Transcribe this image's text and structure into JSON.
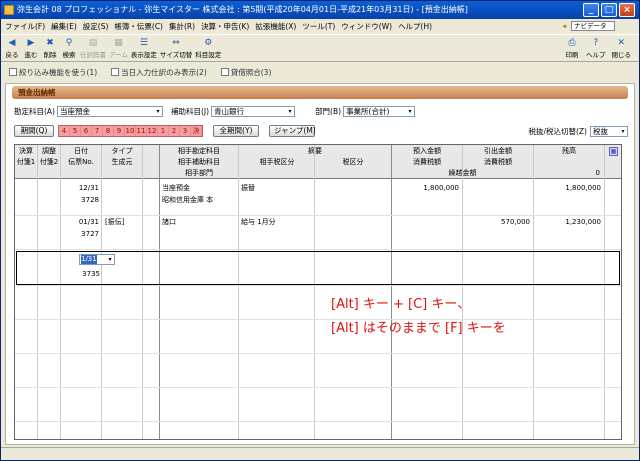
{
  "window": {
    "title": "弥生会計 08 プロフェッショナル - 弥生マイスター 株式会社 : 第5期(平成20年04月01日-平成21年03月31日) - [預金出納帳]"
  },
  "menu": {
    "items": [
      "ファイル(F)",
      "編集(E)",
      "設定(S)",
      "帳簿・伝票(C)",
      "集計(R)",
      "決算・申告(K)",
      "拡張機能(X)",
      "ツール(T)",
      "ウィンドウ(W)",
      "ヘルプ(H)"
    ],
    "navi_label": "ナビデータ"
  },
  "toolbar": {
    "items": [
      {
        "label": "戻る",
        "icon": "back-arrow-icon",
        "enabled": true
      },
      {
        "label": "進む",
        "icon": "forward-arrow-icon",
        "enabled": true
      },
      {
        "label": "削除",
        "icon": "delete-icon",
        "enabled": true
      },
      {
        "label": "検索",
        "icon": "search-icon",
        "enabled": true
      },
      {
        "label": "仕訳辞書",
        "icon": "dictionary-icon",
        "enabled": false
      },
      {
        "label": "アーム",
        "icon": "arm-icon",
        "enabled": false
      },
      {
        "label": "表示設定",
        "icon": "display-settings-icon",
        "enabled": true
      },
      {
        "label": "サイズ切替",
        "icon": "resize-icon",
        "enabled": true
      },
      {
        "label": "科目設定",
        "icon": "account-settings-icon",
        "enabled": true
      }
    ],
    "right": [
      {
        "label": "印刷",
        "icon": "print-icon"
      },
      {
        "label": "ヘルプ",
        "icon": "help-icon"
      },
      {
        "label": "閉じる",
        "icon": "close-icon"
      }
    ]
  },
  "options": {
    "items": [
      "絞り込み機能を使う(1)",
      "当日入力仕訳のみ表示(2)",
      "貸借照合(3)"
    ]
  },
  "panel": {
    "title": "預金出納帳",
    "account_label": "勘定科目(A)",
    "account_value": "当座預金",
    "sub_account_label": "補助科目(J)",
    "sub_account_value": "青山銀行",
    "department_label": "部門(B)",
    "department_value": "事業所(合計)",
    "period_button": "期間(Q)",
    "months": [
      "4",
      "5",
      "6",
      "7",
      "8",
      "9",
      "10",
      "11",
      "12",
      "1",
      "2",
      "3",
      "決"
    ],
    "all_period_button": "全期間(Y)",
    "jump_button": "ジャンプ(M)",
    "tax_label": "税抜/税込切替(Z)",
    "tax_value": "税抜"
  },
  "grid": {
    "headers": {
      "kessan": "決算",
      "chosei": "調整",
      "date": "日付",
      "type": "タイプ",
      "fusen1": "付箋1",
      "fusen2": "付箋2",
      "denpyo": "伝票No.",
      "seisei": "生成元",
      "aite": "相手勘定科目",
      "aite_hojo": "相手補助科目",
      "aite_bumon": "相手部門",
      "tekiyo": "摘要",
      "aite_zei": "相手税区分",
      "zei": "税区分",
      "nyukin": "預入金額",
      "shohizei1": "消費税額",
      "hikidashi": "引出金額",
      "shohizei2": "消費税額",
      "zandaka": "残高",
      "kurikoshi": "繰越金額"
    },
    "carry_over": "0",
    "rows": [
      {
        "date": "12/31",
        "denpyo": "3728",
        "type": "",
        "aite": "当座預金",
        "aite_hojo": "昭和信用金庫 本",
        "tekiyo": "振替",
        "nyukin": "1,800,000",
        "hikidashi": "",
        "zandaka": "1,800,000"
      },
      {
        "date": "01/31",
        "denpyo": "3727",
        "type": "[振伝]",
        "aite": "諸口",
        "aite_hojo": "",
        "tekiyo": "給与 1月分",
        "nyukin": "",
        "hikidashi": "570,000",
        "zandaka": "1,230,000"
      }
    ],
    "new_row": {
      "date": "1/31",
      "denpyo": "3735"
    }
  },
  "annotation": {
    "line1": "[Alt] キー + [C] キー、",
    "line2": "[Alt] はそのままで [F] キーを"
  }
}
